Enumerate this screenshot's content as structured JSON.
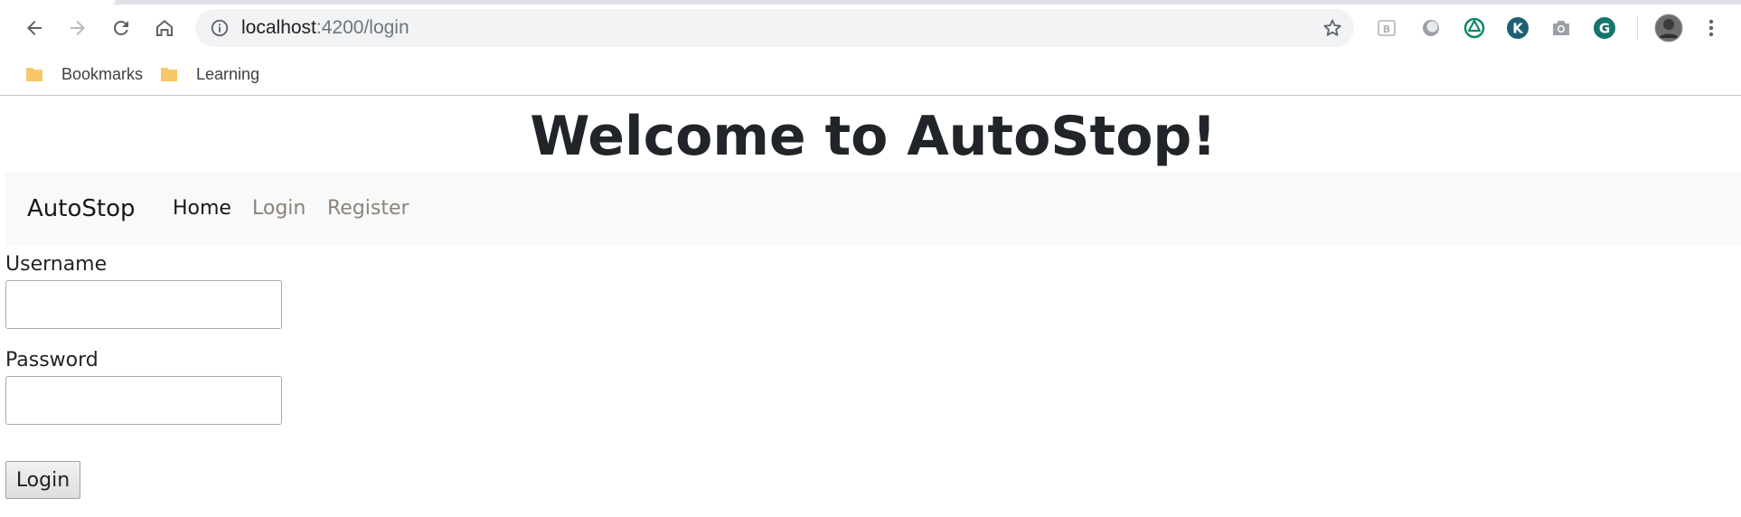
{
  "browser": {
    "url_host": "localhost",
    "url_path": ":4200/login",
    "nav_icons": [
      "back-arrow-icon",
      "forward-arrow-icon",
      "reload-icon",
      "home-icon"
    ],
    "extension_icons": [
      "b-extension-icon",
      "circle-extension-icon",
      "spiral-extension-icon",
      "k-extension-icon",
      "camera-icon",
      "grammarly-icon"
    ],
    "accent_color": "#1a73e8"
  },
  "bookmarks": [
    {
      "label": "Bookmarks",
      "icon": "folder-icon"
    },
    {
      "label": "Learning",
      "icon": "folder-icon"
    }
  ],
  "page": {
    "title": "Welcome to AutoStop!",
    "navbar": {
      "brand": "AutoStop",
      "links": [
        {
          "label": "Home",
          "active": true
        },
        {
          "label": "Login",
          "active": false
        },
        {
          "label": "Register",
          "active": false
        }
      ],
      "background": "#f8f9fa"
    },
    "form": {
      "username_label": "Username",
      "username_value": "",
      "password_label": "Password",
      "password_value": "",
      "submit_label": "Login"
    }
  }
}
